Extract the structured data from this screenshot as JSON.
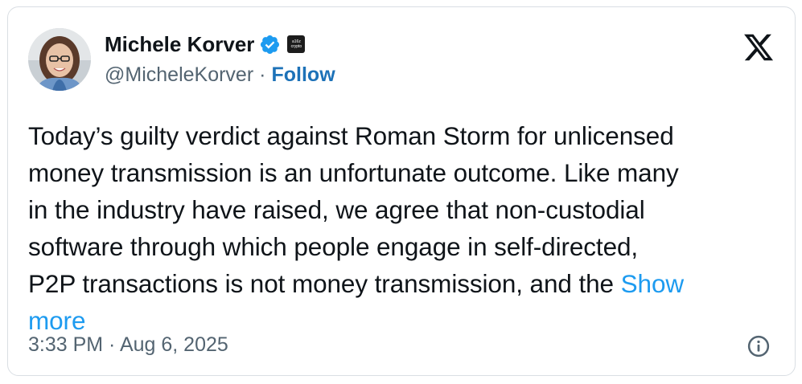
{
  "author": {
    "display_name": "Michele Korver",
    "handle": "@MicheleKorver",
    "separator": "·",
    "follow_label": "Follow",
    "avatar_icon": "profile-photo",
    "verified_icon": "verified-badge-icon",
    "affiliate_badge": {
      "line1": "a16z",
      "line2": "crypto"
    }
  },
  "tweet": {
    "lines": [
      "Today’s guilty verdict against Roman Storm for unlicensed",
      "money transmission is an unfortunate  outcome. Like many",
      "in the industry have raised, we agree that non-custodial",
      "software through which people engage in self-directed,",
      "P2P transactions is not money transmission, and the "
    ],
    "show_more_part1": "Show",
    "show_more_part2": "more",
    "timestamp": "3:33 PM · Aug 6, 2025"
  },
  "icons": {
    "platform_logo": "x-logo-icon",
    "info": "info-icon"
  },
  "colors": {
    "text": "#0f1419",
    "secondary": "#536471",
    "link": "#1d9bf0",
    "follow": "#1d72b8",
    "verified": "#1d9bf0",
    "border": "#d9dee3"
  }
}
